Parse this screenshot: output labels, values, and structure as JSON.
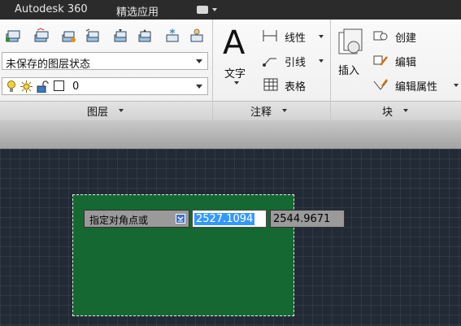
{
  "tabs": [
    {
      "label": "Autodesk 360"
    },
    {
      "label": "精选应用"
    }
  ],
  "layers": {
    "state_dropdown": "未保存的图层状态",
    "current_layer": "0",
    "title": "图层"
  },
  "annotation": {
    "text_label": "文字",
    "linear_label": "线性",
    "leader_label": "引线",
    "table_label": "表格",
    "title": "注释"
  },
  "block": {
    "insert_label": "插入",
    "create_label": "创建",
    "edit_label": "编辑",
    "edit_attr_label": "编辑属性",
    "title": "块"
  },
  "command": {
    "prompt": "指定对角点或",
    "x_value": "2527.1094",
    "y_value": "2544.9671"
  },
  "colors": {
    "selection_fill": "#166e32",
    "canvas_bg": "#222a36",
    "highlight": "#3399ff"
  }
}
